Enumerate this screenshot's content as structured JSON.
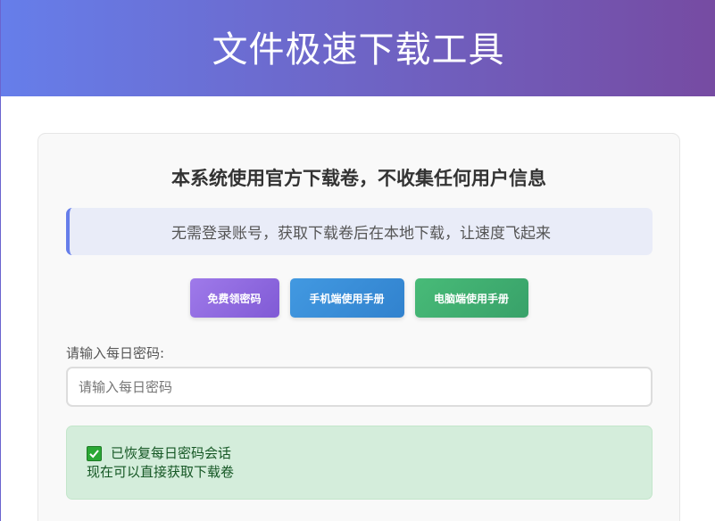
{
  "header": {
    "title": "文件极速下载工具"
  },
  "card": {
    "notice_title": "本系统使用官方下载卷，不收集任何用户信息",
    "info_text": "无需登录账号，获取下载卷后在本地下载，让速度飞起来",
    "buttons": {
      "free_password": "免费领密码",
      "mobile_manual": "手机端使用手册",
      "pc_manual": "电脑端使用手册"
    },
    "password_field": {
      "label": "请输入每日密码:",
      "placeholder": "请输入每日密码",
      "value": ""
    },
    "status": {
      "icon": "check-icon",
      "line1": "已恢复每日密码会话",
      "line2": "现在可以直接获取下载卷"
    }
  },
  "colors": {
    "header_gradient_start": "#667eea",
    "header_gradient_end": "#764ba2",
    "success_bg": "#d4eddb",
    "success_text": "#155724"
  }
}
